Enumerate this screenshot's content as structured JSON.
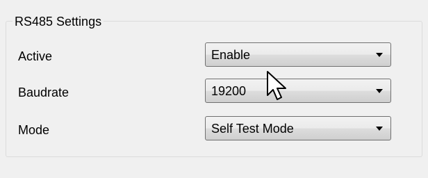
{
  "group": {
    "title": "RS485 Settings"
  },
  "rows": [
    {
      "label": "Active",
      "value": "Enable"
    },
    {
      "label": "Baudrate",
      "value": "19200"
    },
    {
      "label": "Mode",
      "value": "Self Test Mode"
    }
  ],
  "icons": {
    "dropdown_arrow": "chevron-down-icon",
    "cursor": "mouse-pointer-icon"
  },
  "colors": {
    "background": "#f0f0f0",
    "group_border": "#dcdcdc",
    "combo_border": "#707070"
  }
}
